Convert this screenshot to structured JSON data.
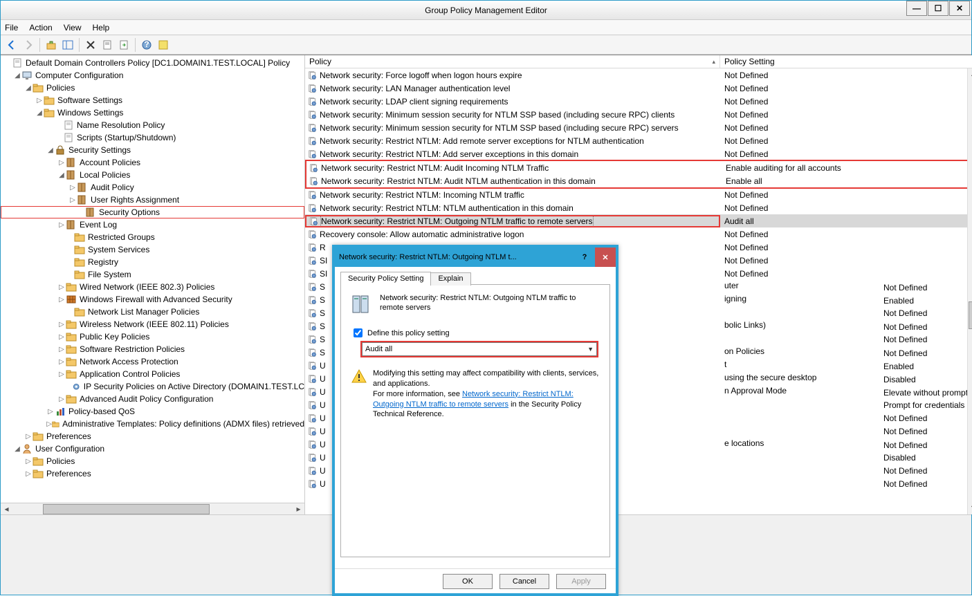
{
  "window": {
    "title": "Group Policy Management Editor",
    "min": "—",
    "max": "☐",
    "close": "✕"
  },
  "menu": {
    "file": "File",
    "action": "Action",
    "view": "View",
    "help": "Help"
  },
  "tree": {
    "root": "Default Domain Controllers Policy [DC1.DOMAIN1.TEST.LOCAL] Policy",
    "compConfig": "Computer Configuration",
    "policies": "Policies",
    "softwareSettings": "Software Settings",
    "windowsSettings": "Windows Settings",
    "nameRes": "Name Resolution Policy",
    "scripts": "Scripts (Startup/Shutdown)",
    "security": "Security Settings",
    "account": "Account Policies",
    "local": "Local Policies",
    "auditPol": "Audit Policy",
    "userRights": "User Rights Assignment",
    "secOptions": "Security Options",
    "eventLog": "Event Log",
    "restrictedGroups": "Restricted Groups",
    "systemServices": "System Services",
    "registry": "Registry",
    "fileSystem": "File System",
    "wired": "Wired Network (IEEE 802.3) Policies",
    "wfas": "Windows Firewall with Advanced Security",
    "nlmp": "Network List Manager Policies",
    "wireless": "Wireless Network (IEEE 802.11) Policies",
    "pkp": "Public Key Policies",
    "srp": "Software Restriction Policies",
    "nap": "Network Access Protection",
    "acp": "Application Control Policies",
    "ipsec": "IP Security Policies on Active Directory (DOMAIN1.TEST.LC",
    "advAudit": "Advanced Audit Policy Configuration",
    "pbq": "Policy-based QoS",
    "admTemplates": "Administrative Templates: Policy definitions (ADMX files) retrieved",
    "prefs": "Preferences",
    "userConfig": "User Configuration",
    "userPol": "Policies",
    "userPrefs": "Preferences"
  },
  "list": {
    "header": {
      "policy": "Policy",
      "setting": "Policy Setting"
    },
    "rows": [
      {
        "name": "Network security: Force logoff when logon hours expire",
        "val": "Not Defined"
      },
      {
        "name": "Network security: LAN Manager authentication level",
        "val": "Not Defined"
      },
      {
        "name": "Network security: LDAP client signing requirements",
        "val": "Not Defined"
      },
      {
        "name": "Network security: Minimum session security for NTLM SSP based (including secure RPC) clients",
        "val": "Not Defined"
      },
      {
        "name": "Network security: Minimum session security for NTLM SSP based (including secure RPC) servers",
        "val": "Not Defined"
      },
      {
        "name": "Network security: Restrict NTLM: Add remote server exceptions for NTLM authentication",
        "val": "Not Defined"
      },
      {
        "name": "Network security: Restrict NTLM: Add server exceptions in this domain",
        "val": "Not Defined"
      },
      {
        "name": "Network security: Restrict NTLM: Audit Incoming NTLM Traffic",
        "val": "Enable auditing for all accounts"
      },
      {
        "name": "Network security: Restrict NTLM: Audit NTLM authentication in this domain",
        "val": "Enable all"
      },
      {
        "name": "Network security: Restrict NTLM: Incoming NTLM traffic",
        "val": "Not Defined"
      },
      {
        "name": "Network security: Restrict NTLM: NTLM authentication in this domain",
        "val": "Not Defined"
      },
      {
        "name": "Network security: Restrict NTLM: Outgoing NTLM traffic to remote servers",
        "val": "Audit all"
      },
      {
        "name": "Recovery console: Allow automatic administrative logon",
        "val": "Not Defined"
      },
      {
        "name": "R",
        "val": "Not Defined"
      },
      {
        "name": "SI",
        "val": "Not Defined"
      },
      {
        "name": "SI",
        "val": "Not Defined"
      },
      {
        "name": "S",
        "val": "uter",
        "tail": "Not Defined"
      },
      {
        "name": "S",
        "val": "igning",
        "tail": "Enabled"
      },
      {
        "name": "S",
        "val": "",
        "tail": "Not Defined"
      },
      {
        "name": "S",
        "val": "bolic Links)",
        "tail": "Not Defined"
      },
      {
        "name": "S",
        "val": "",
        "tail": "Not Defined"
      },
      {
        "name": "S",
        "val": "on Policies",
        "tail": "Not Defined"
      },
      {
        "name": "U",
        "val": "t",
        "tail": "Enabled"
      },
      {
        "name": "U",
        "val": "using the secure desktop",
        "tail": "Disabled"
      },
      {
        "name": "U",
        "val": "n Approval Mode",
        "tail": "Elevate without prompting"
      },
      {
        "name": "U",
        "val": "",
        "tail": "Prompt for credentials"
      },
      {
        "name": "U",
        "val": "",
        "tail": "Not Defined"
      },
      {
        "name": "U",
        "val": "",
        "tail": "Not Defined"
      },
      {
        "name": "U",
        "val": "e locations",
        "tail": "Not Defined"
      },
      {
        "name": "U",
        "val": "",
        "tail": "Disabled"
      },
      {
        "name": "U",
        "val": "",
        "tail": "Not Defined"
      },
      {
        "name": "U",
        "val": "",
        "tail": "Not Defined"
      }
    ]
  },
  "dialog": {
    "title": "Network security: Restrict NTLM: Outgoing NTLM t...",
    "tab1": "Security Policy Setting",
    "tab2": "Explain",
    "policyName": "Network security: Restrict NTLM: Outgoing NTLM traffic to remote servers",
    "define": "Define this policy setting",
    "value": "Audit all",
    "warn1": "Modifying this setting may affect compatibility with clients, services, and applications.",
    "warn2a": "For more information, see ",
    "link": "Network security: Restrict NTLM: Outgoing NTLM traffic to remote servers",
    "warn2b": " in the Security Policy Technical Reference.",
    "ok": "OK",
    "cancel": "Cancel",
    "apply": "Apply"
  }
}
